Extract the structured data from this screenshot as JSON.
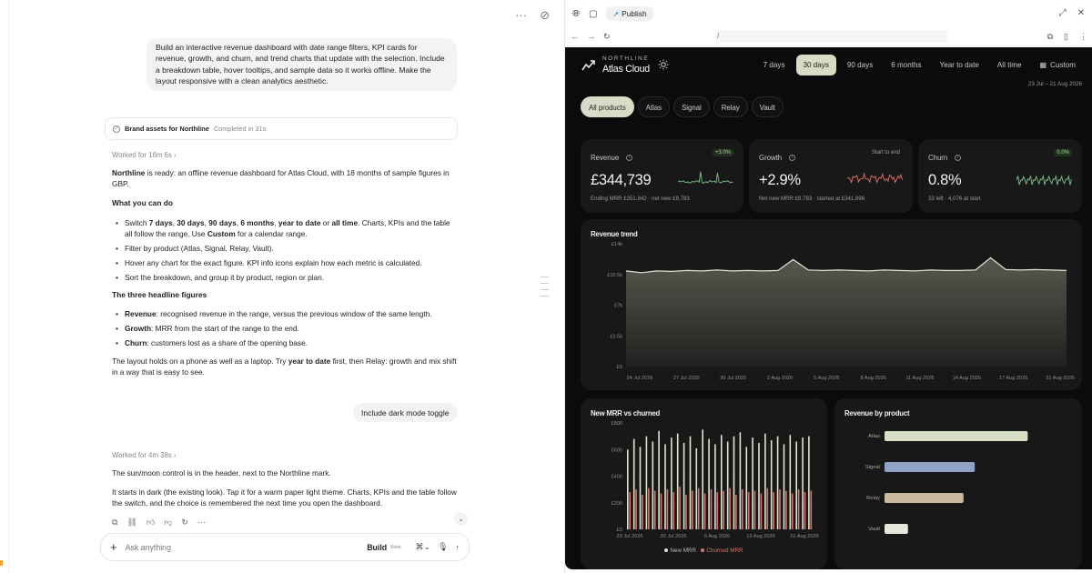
{
  "chat": {
    "top_icons": [
      "more-icon",
      "link-icon"
    ],
    "prompt": "Build an interactive revenue dashboard with date range filters, KPI cards for revenue, growth, and churn, and trend charts that update with the selection. Include a breakdown table, hover tooltips, and sample data so it works offline. Make the layout responsive with a clean analytics aesthetic.",
    "task_card": {
      "title": "Brand assets for Northline",
      "status": "Completed in 31s"
    },
    "worked1": "Worked for 16m 6s",
    "intro_bold": "Northline",
    "intro_rest": " is ready: an offline revenue dashboard for Atlas Cloud, with 18 months of sample figures in GBP.",
    "what_heading": "What you can do",
    "b1_p1": "Switch ",
    "b1_b1": "7 days",
    "b1_c1": ", ",
    "b1_b2": "30 days",
    "b1_c2": ", ",
    "b1_b3": "90 days",
    "b1_c3": ", ",
    "b1_b4": "6 months",
    "b1_c4": ", ",
    "b1_b5": "year to date",
    "b1_or": " or ",
    "b1_b6": "all time",
    "b1_p2": ". Charts, KPIs and the table all follow the range. Use ",
    "b1_b7": "Custom",
    "b1_p3": " for a calendar range.",
    "b2": "Filter by product (Atlas, Signal, Relay, Vault).",
    "b3": "Hover any chart for the exact figure. KPI info icons explain how each metric is calculated.",
    "b4": "Sort the breakdown, and group it by product, region or plan.",
    "three_heading": "The three headline figures",
    "f1_b": "Revenue",
    "f1_t": ": recognised revenue in the range, versus the previous window of the same length.",
    "f2_b": "Growth",
    "f2_t": ": MRR from the start of the range to the end.",
    "f3_b": "Churn",
    "f3_t": ": customers lost as a share of the opening base.",
    "layout_p1": "The layout holds on a phone as well as a laptop. Try ",
    "layout_b": "year to date",
    "layout_p2": " first, then Relay: growth and mix shift in a way that is easy to see.",
    "prompt2": "Include dark mode toggle",
    "worked2": "Worked for 4m 38s",
    "reply1": "The sun/moon control is in the header, next to the Northline mark.",
    "reply2": "It starts in dark (the existing look). Tap it for a warm paper light theme. Charts, KPIs and the table follow the switch, and the choice is remembered the next time you open the dashboard.",
    "composer": {
      "placeholder": "Ask anything",
      "mode": "Build",
      "beta": "Beta"
    }
  },
  "browser": {
    "publish": "Publish",
    "url": "/"
  },
  "dashboard": {
    "eyebrow": "NORTHLINE",
    "brand": "Atlas Cloud",
    "ranges": [
      "7 days",
      "30 days",
      "90 days",
      "6 months",
      "Year to date",
      "All time"
    ],
    "active_range": "30 days",
    "custom": "Custom",
    "date_range": "23 Jul – 21 Aug 2026",
    "products": [
      "All products",
      "Atlas",
      "Signal",
      "Relay",
      "Vault"
    ],
    "active_product": "All products",
    "kpis": [
      {
        "label": "Revenue",
        "badge": "+3.0%",
        "value": "£344,739",
        "sub": "Ending MRR £351,842 · net new £8,783",
        "spark_color": "#7fc48a"
      },
      {
        "label": "Growth",
        "badge": "Start to end",
        "value": "+2.9%",
        "sub": "Net new MRR £8,783 · started at £341,896",
        "spark_color": "#d9776f"
      },
      {
        "label": "Churn",
        "badge": "0.0%",
        "value": "0.8%",
        "sub": "33 left · 4,076 at start",
        "spark_color": "#7fc48a"
      }
    ],
    "colors": {
      "accent": "#d7dcc7",
      "new_mrr": "#dfe4cf",
      "churned_mrr": "#d9776f",
      "atlas": "#d6dfc4",
      "signal": "#8fa3c6",
      "relay": "#cbb9a0",
      "vault": "#e6e6da"
    },
    "trend_title": "Revenue trend",
    "mrr_title": "New MRR vs churned",
    "product_title": "Revenue by product",
    "legend_new": "New MRR",
    "legend_churn": "Churned MRR"
  },
  "chart_data": [
    {
      "type": "area",
      "title": "Revenue trend",
      "yticks": [
        "£14k",
        "£10.5k",
        "£7k",
        "£3.5k",
        "£0"
      ],
      "ylim": [
        0,
        14000
      ],
      "xticks": [
        "24 Jul 2026",
        "27 Jul 2026",
        "30 Jul 2026",
        "2 Aug 2026",
        "5 Aug 2026",
        "8 Aug 2026",
        "11 Aug 2026",
        "14 Aug 2026",
        "17 Aug 2026",
        "21 Aug 2026"
      ],
      "x": [
        "23 Jul",
        "24 Jul",
        "25 Jul",
        "26 Jul",
        "27 Jul",
        "28 Jul",
        "29 Jul",
        "30 Jul",
        "31 Jul",
        "1 Aug",
        "2 Aug",
        "3 Aug",
        "4 Aug",
        "5 Aug",
        "6 Aug",
        "7 Aug",
        "8 Aug",
        "9 Aug",
        "10 Aug",
        "11 Aug",
        "12 Aug",
        "13 Aug",
        "14 Aug",
        "15 Aug",
        "16 Aug",
        "17 Aug",
        "18 Aug",
        "19 Aug",
        "20 Aug",
        "21 Aug"
      ],
      "values": [
        10900,
        10700,
        10900,
        10850,
        10950,
        10900,
        11000,
        10900,
        10950,
        10900,
        10950,
        12200,
        11000,
        10950,
        11000,
        10950,
        10900,
        11000,
        10950,
        10900,
        11000,
        10950,
        10950,
        11000,
        12400,
        11050,
        11000,
        11050,
        11000,
        10950
      ]
    },
    {
      "type": "bar",
      "title": "New MRR vs churned",
      "yticks": [
        "£800",
        "£600",
        "£400",
        "£200",
        "£0"
      ],
      "ylim": [
        0,
        800
      ],
      "xticks": [
        "23 Jul 2026",
        "30 Jul 2026",
        "6 Aug 2026",
        "13 Aug 2026",
        "21 Aug 2026"
      ],
      "series": [
        {
          "name": "New MRR",
          "values": [
            600,
            680,
            620,
            700,
            660,
            740,
            640,
            690,
            720,
            650,
            700,
            610,
            750,
            680,
            640,
            710,
            660,
            700,
            730,
            620,
            690,
            650,
            720,
            670,
            700,
            640,
            710,
            660,
            690,
            700
          ]
        },
        {
          "name": "Churned MRR",
          "values": [
            280,
            300,
            260,
            310,
            290,
            270,
            300,
            280,
            320,
            260,
            290,
            310,
            270,
            300,
            280,
            290,
            310,
            260,
            300,
            280,
            290,
            270,
            310,
            280,
            300,
            290,
            270,
            300,
            280,
            290
          ]
        }
      ]
    },
    {
      "type": "bar",
      "orientation": "horizontal",
      "title": "Revenue by product",
      "categories": [
        "Atlas",
        "Signal",
        "Relay",
        "Vault"
      ],
      "values": [
        165000,
        104000,
        91000,
        27000
      ]
    }
  ]
}
